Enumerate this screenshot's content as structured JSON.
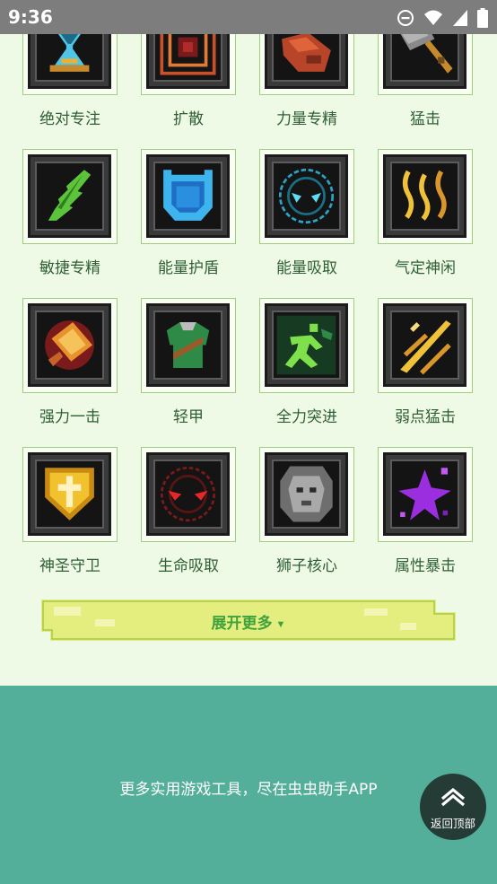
{
  "status": {
    "time": "9:36",
    "icons": [
      "do-not-disturb-icon",
      "wifi-icon",
      "signal-icon",
      "battery-icon"
    ]
  },
  "skills": [
    {
      "name": "绝对专注",
      "icon": "hourglass-icon"
    },
    {
      "name": "扩散",
      "icon": "spread-icon"
    },
    {
      "name": "力量专精",
      "icon": "fist-icon"
    },
    {
      "name": "猛击",
      "icon": "hammer-icon"
    },
    {
      "name": "敏捷专精",
      "icon": "feather-icon"
    },
    {
      "name": "能量护盾",
      "icon": "energy-shield-icon"
    },
    {
      "name": "能量吸取",
      "icon": "energy-absorb-icon"
    },
    {
      "name": "气定神闲",
      "icon": "calm-flames-icon"
    },
    {
      "name": "强力一击",
      "icon": "power-strike-sword-icon"
    },
    {
      "name": "轻甲",
      "icon": "light-armor-icon"
    },
    {
      "name": "全力突进",
      "icon": "dash-runner-icon"
    },
    {
      "name": "弱点猛击",
      "icon": "weak-point-slash-icon"
    },
    {
      "name": "神圣守卫",
      "icon": "holy-shield-icon"
    },
    {
      "name": "生命吸取",
      "icon": "life-steal-eyes-icon"
    },
    {
      "name": "狮子核心",
      "icon": "lion-core-icon"
    },
    {
      "name": "属性暴击",
      "icon": "element-crit-icon"
    }
  ],
  "expand_button": {
    "label": "展开更多",
    "icon": "triangle-down-icon"
  },
  "footer": {
    "message": "更多实用游戏工具，尽在虫虫助手APP"
  },
  "back_to_top": {
    "label": "返回顶部",
    "icon": "double-chevron-up-icon"
  },
  "colors": {
    "page_bg": "#eef9e6",
    "footer_bg": "#53ae9a",
    "label_text": "#2f5f35",
    "tile_border": "#9ccf7e",
    "expand_text": "#3da23d",
    "expand_bar": "#e3ee7e"
  }
}
